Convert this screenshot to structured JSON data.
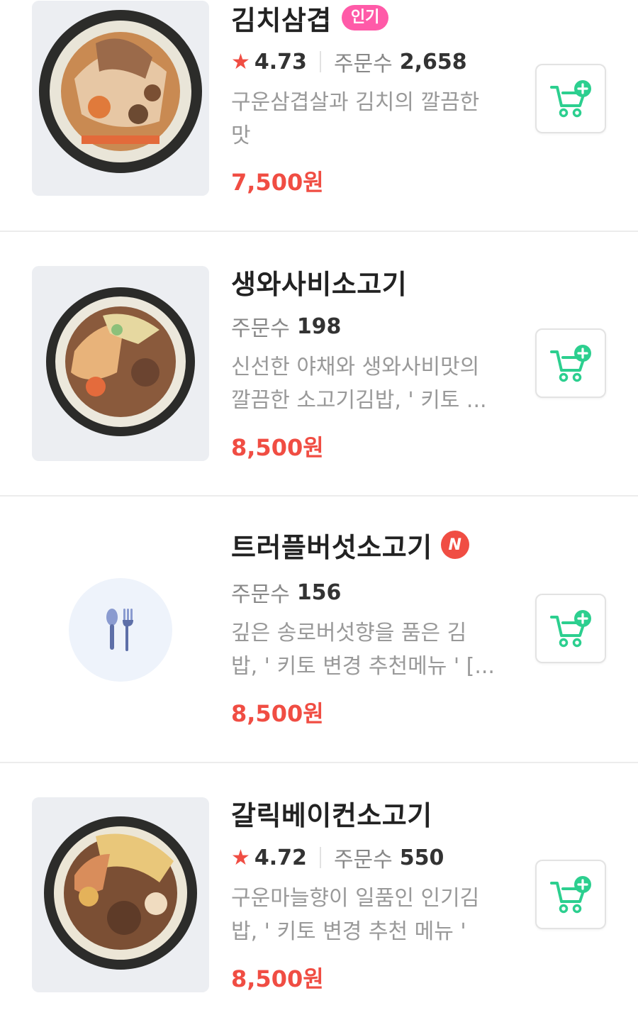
{
  "menu_items": [
    {
      "name": "김치삼겹",
      "badge": "인기",
      "rating": "4.73",
      "orders_label": "주문수",
      "orders": "2,658",
      "description_line1": "구운삼겹살과 김치의 깔끔한",
      "description_line2": "맛",
      "price": "7,500원"
    },
    {
      "name": "생와사비소고기",
      "orders_label": "주문수",
      "orders": "198",
      "description_line1": "신선한 야채와 생와사비맛의",
      "description_line2": "깔끔한 소고기김밥, ' 키토 ...",
      "price": "8,500원"
    },
    {
      "name": "트러플버섯소고기",
      "badge": "N",
      "orders_label": "주문수",
      "orders": "156",
      "description_line1": "깊은 송로버섯향을 품은 김",
      "description_line2": "밥, ' 키토 변경 추천메뉴 ' [...",
      "price": "8,500원"
    },
    {
      "name": "갈릭베이컨소고기",
      "rating": "4.72",
      "orders_label": "주문수",
      "orders": "550",
      "description_line1": "구운마늘향이 일품인 인기김",
      "description_line2": "밥, ' 키토 변경 추천 메뉴 '",
      "price": "8,500원"
    }
  ],
  "icons": {
    "cart_add": "cart-plus-icon",
    "star": "star-icon",
    "placeholder": "fork-spoon-icon"
  },
  "colors": {
    "accent": "#f04d43",
    "cart_green": "#2ccf8f",
    "popular_badge": "#ff5aa8",
    "placeholder_bg": "#eef3fb",
    "placeholder_icon": "#8a9bd0"
  }
}
